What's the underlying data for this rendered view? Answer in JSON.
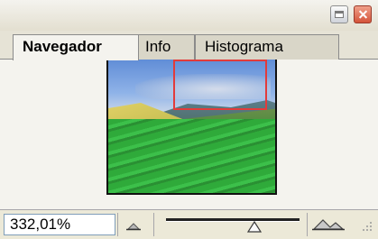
{
  "tabs": [
    {
      "label": "Navegador",
      "active": true
    },
    {
      "label": "Info",
      "active": false
    },
    {
      "label": "Histograma",
      "active": false
    }
  ],
  "more_tabs_glyph": "»",
  "window_buttons": [
    "minimize-icon",
    "close-icon"
  ],
  "zoom": {
    "value": "332,01%",
    "slider_fraction": 0.66
  },
  "icons": {
    "zoom_out": "small-mountain-icon",
    "zoom_in": "large-mountains-icon"
  },
  "colors": {
    "view_rectangle": "#e23b3b"
  }
}
